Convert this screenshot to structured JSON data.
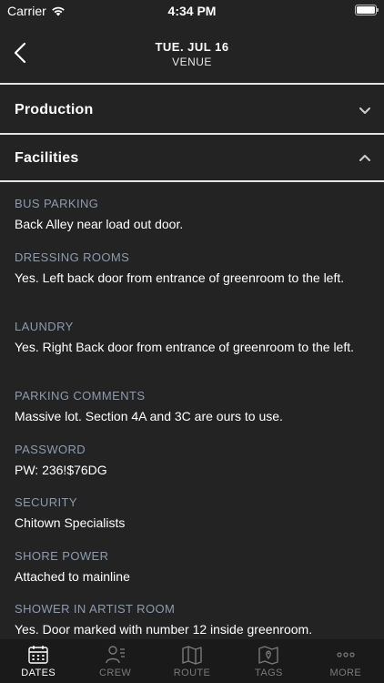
{
  "status": {
    "carrier": "Carrier",
    "time": "4:34 PM"
  },
  "nav": {
    "title": "TUE. JUL 16",
    "subtitle": "VENUE"
  },
  "sections": {
    "production": {
      "title": "Production",
      "expanded": false
    },
    "facilities": {
      "title": "Facilities",
      "expanded": true
    }
  },
  "fields": [
    {
      "label": "BUS PARKING",
      "value": "Back Alley near load out door."
    },
    {
      "label": "DRESSING ROOMS",
      "value": "Yes. Left back door from entrance of greenroom to the left."
    },
    {
      "label": "LAUNDRY",
      "value": "Yes. Right Back door from entrance of greenroom to the left."
    },
    {
      "label": "PARKING COMMENTS",
      "value": "Massive lot. Section 4A and 3C are ours to use."
    },
    {
      "label": "PASSWORD",
      "value": "PW: 236!$76DG"
    },
    {
      "label": "SECURITY",
      "value": "Chitown Specialists"
    },
    {
      "label": "SHORE POWER",
      "value": "Attached to mainline"
    },
    {
      "label": "SHOWER IN ARTIST ROOM",
      "value": "Yes. Door marked with number 12 inside greenroom."
    }
  ],
  "tabs": [
    {
      "label": "DATES",
      "icon": "calendar-icon",
      "active": true
    },
    {
      "label": "CREW",
      "icon": "crew-icon",
      "active": false
    },
    {
      "label": "ROUTE",
      "icon": "map-icon",
      "active": false
    },
    {
      "label": "TAGS",
      "icon": "tag-map-icon",
      "active": false
    },
    {
      "label": "MORE",
      "icon": "more-icon",
      "active": false
    }
  ],
  "colors": {
    "background": "#232323",
    "label": "#8d9bb0",
    "text": "#ffffff",
    "tab_bar": "#1a1a1a",
    "tab_inactive": "#7a7a7a"
  }
}
